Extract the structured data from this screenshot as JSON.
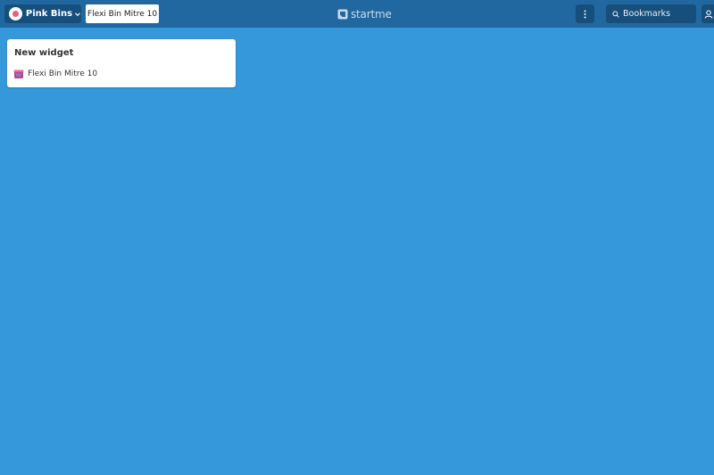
{
  "topbar": {
    "page_switcher": {
      "label": "Pink Bins",
      "avatar_color": "#e85d8a"
    },
    "tabs": [
      {
        "label": "Flexi Bin Mitre 10"
      }
    ],
    "logo": {
      "text": "startme"
    },
    "menu_icon": "vertical-ellipsis-icon",
    "search": {
      "label": "Bookmarks",
      "icon": "search-icon"
    },
    "user_icon": "user-icon"
  },
  "widgets": [
    {
      "title": "New widget",
      "bookmarks": [
        {
          "label": "Flexi Bin Mitre 10",
          "icon": "flexi-bin-favicon"
        }
      ]
    }
  ],
  "colors": {
    "background": "#3498db",
    "topbar": "#2268a0",
    "topbar_button": "#174f7c",
    "card": "#ffffff"
  }
}
